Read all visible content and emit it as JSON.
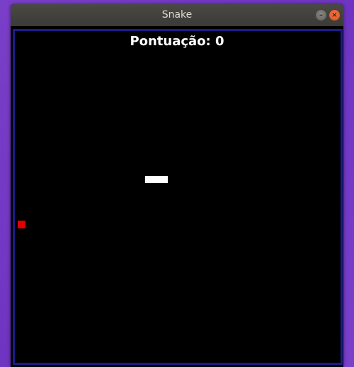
{
  "window": {
    "title": "Snake",
    "minimize_icon": "minimize-icon",
    "close_icon": "close-icon"
  },
  "game": {
    "score_label": "Pontuação: 0",
    "snake_color": "#ffffff",
    "food_color": "#e00000",
    "border_color": "#1d1a8c",
    "background_color": "#000000"
  }
}
